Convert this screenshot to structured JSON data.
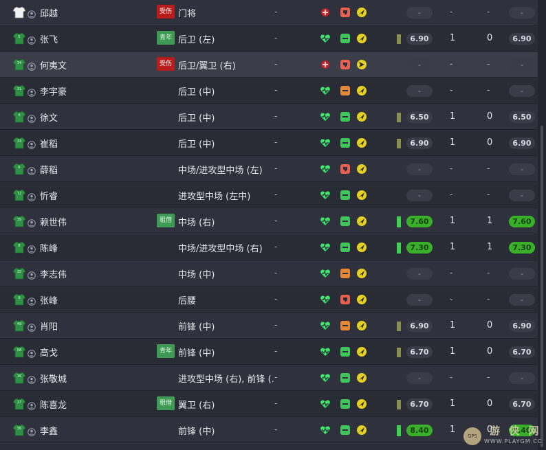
{
  "players": [
    {
      "number": "",
      "kit": "white",
      "name": "邱越",
      "badge": {
        "type": "injury",
        "label": "受伤"
      },
      "position": "门将",
      "col_dash": "-",
      "condition": "injured",
      "morale": "bad",
      "arrow": "up",
      "bar": "",
      "avg": "-",
      "apps": "-",
      "goals": "-",
      "last": "-"
    },
    {
      "number": "5",
      "kit": "green",
      "name": "张飞",
      "badge": {
        "type": "youth",
        "label": "青年"
      },
      "position": "后卫 (左)",
      "col_dash": "-",
      "condition": "full",
      "morale": "ok",
      "arrow": "up",
      "bar": "lo",
      "avg": "6.90",
      "apps": "1",
      "goals": "0",
      "last": "6.90"
    },
    {
      "number": "34",
      "kit": "green",
      "name": "何夷文",
      "badge": {
        "type": "injury",
        "label": "受伤"
      },
      "position": "后卫/翼卫 (右)",
      "col_dash": "-",
      "condition": "injured",
      "morale": "bad",
      "arrow": "right",
      "bar": "",
      "avg": "-",
      "apps": "-",
      "goals": "-",
      "last": "-"
    },
    {
      "number": "31",
      "kit": "green",
      "name": "李宇豪",
      "badge": null,
      "position": "后卫 (中)",
      "col_dash": "-",
      "condition": "full",
      "morale": "low",
      "arrow": "up",
      "bar": "",
      "avg": "-",
      "apps": "-",
      "goals": "-",
      "last": "-"
    },
    {
      "number": "4",
      "kit": "green",
      "name": "徐文",
      "badge": null,
      "position": "后卫 (中)",
      "col_dash": "-",
      "condition": "full",
      "morale": "ok",
      "arrow": "up",
      "bar": "lo",
      "avg": "6.50",
      "apps": "1",
      "goals": "0",
      "last": "6.50"
    },
    {
      "number": "33",
      "kit": "green",
      "name": "崔稻",
      "badge": null,
      "position": "后卫 (中)",
      "col_dash": "-",
      "condition": "full",
      "morale": "ok",
      "arrow": "up",
      "bar": "lo",
      "avg": "6.90",
      "apps": "1",
      "goals": "0",
      "last": "6.90"
    },
    {
      "number": "6",
      "kit": "green",
      "name": "薛稻",
      "badge": null,
      "position": "中场/进攻型中场 (左)",
      "col_dash": "-",
      "condition": "full",
      "morale": "bad",
      "arrow": "up",
      "bar": "",
      "avg": "-",
      "apps": "-",
      "goals": "-",
      "last": "-"
    },
    {
      "number": "12",
      "kit": "green",
      "name": "忻睿",
      "badge": null,
      "position": "进攻型中场 (左中)",
      "col_dash": "-",
      "condition": "full",
      "morale": "ok",
      "arrow": "up",
      "bar": "",
      "avg": "-",
      "apps": "-",
      "goals": "-",
      "last": "-"
    },
    {
      "number": "35",
      "kit": "green",
      "name": "赖世伟",
      "badge": {
        "type": "loan",
        "label": "租借"
      },
      "position": "中场 (右)",
      "col_dash": "-",
      "condition": "full",
      "morale": "ok",
      "arrow": "up",
      "bar": "hi",
      "avg": "7.60",
      "apps": "1",
      "goals": "1",
      "last": "7.60"
    },
    {
      "number": "8",
      "kit": "green",
      "name": "陈峰",
      "badge": null,
      "position": "中场/进攻型中场 (右)",
      "col_dash": "-",
      "condition": "full",
      "morale": "ok",
      "arrow": "up",
      "bar": "hi",
      "avg": "7.30",
      "apps": "1",
      "goals": "1",
      "last": "7.30"
    },
    {
      "number": "22",
      "kit": "green",
      "name": "李志伟",
      "badge": null,
      "position": "中场 (中)",
      "col_dash": "-",
      "condition": "full",
      "morale": "low",
      "arrow": "up",
      "bar": "",
      "avg": "-",
      "apps": "-",
      "goals": "-",
      "last": "-"
    },
    {
      "number": "9",
      "kit": "green",
      "name": "张峰",
      "badge": null,
      "position": "后腰",
      "col_dash": "-",
      "condition": "full",
      "morale": "bad",
      "arrow": "up",
      "bar": "",
      "avg": "-",
      "apps": "-",
      "goals": "-",
      "last": "-"
    },
    {
      "number": "49",
      "kit": "green",
      "name": "肖阳",
      "badge": null,
      "position": "前锋 (中)",
      "col_dash": "-",
      "condition": "full",
      "morale": "low",
      "arrow": "up",
      "bar": "lo",
      "avg": "6.90",
      "apps": "1",
      "goals": "0",
      "last": "6.90"
    },
    {
      "number": "58",
      "kit": "green",
      "name": "高戈",
      "badge": {
        "type": "youth",
        "label": "青年"
      },
      "position": "前锋 (中)",
      "col_dash": "-",
      "condition": "tired",
      "morale": "ok",
      "arrow": "up",
      "bar": "lo",
      "avg": "6.70",
      "apps": "1",
      "goals": "0",
      "last": "6.70"
    },
    {
      "number": "18",
      "kit": "green",
      "name": "张敬城",
      "badge": null,
      "position": "进攻型中场 (右), 前锋 (...",
      "col_dash": "-",
      "condition": "full",
      "morale": "ok",
      "arrow": "up",
      "bar": "",
      "avg": "-",
      "apps": "-",
      "goals": "-",
      "last": "-"
    },
    {
      "number": "37",
      "kit": "green",
      "name": "陈喜龙",
      "badge": {
        "type": "loan",
        "label": "租借"
      },
      "position": "翼卫 (右)",
      "col_dash": "-",
      "condition": "full",
      "morale": "ok",
      "arrow": "up",
      "bar": "lo",
      "avg": "6.70",
      "apps": "1",
      "goals": "0",
      "last": "6.70"
    },
    {
      "number": "36",
      "kit": "green",
      "name": "李鑫",
      "badge": null,
      "position": "前锋 (中)",
      "col_dash": "-",
      "condition": "tired",
      "morale": "ok",
      "arrow": "up",
      "bar": "hi",
      "avg": "8.40",
      "apps": "1",
      "goals": "0",
      "last": "8.40"
    }
  ],
  "watermark": {
    "text": "游 侠 网",
    "sub": "WWW.PLAYGM.CC",
    "logo": "GPS"
  },
  "colors": {
    "condition_full": "#3ee66b",
    "injury": "#b81d1d",
    "morale_ok": "#3fc55a",
    "morale_low": "#e4893a",
    "morale_bad": "#e8604f",
    "arrow": "#e5d024",
    "rating_good": "#3ab02a"
  }
}
